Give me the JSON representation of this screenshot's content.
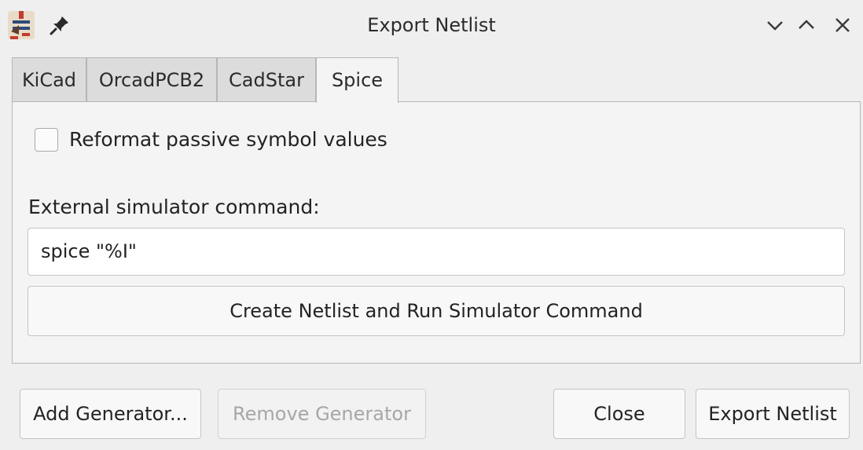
{
  "window": {
    "title": "Export Netlist",
    "icons": {
      "app": "kicad-netlist-app-icon",
      "pin": "pin-icon",
      "minimize": "chevron-down-icon",
      "maximize": "chevron-up-icon",
      "close": "close-icon"
    }
  },
  "tabs": [
    {
      "label": "KiCad",
      "active": false
    },
    {
      "label": "OrcadPCB2",
      "active": false
    },
    {
      "label": "CadStar",
      "active": false
    },
    {
      "label": "Spice",
      "active": true
    }
  ],
  "spice": {
    "reformat_label": "Reformat passive symbol values",
    "reformat_checked": false,
    "command_label": "External simulator command:",
    "command_value": "spice \"%I\"",
    "run_button": "Create Netlist and Run Simulator Command"
  },
  "footer": {
    "add_generator": "Add Generator...",
    "remove_generator": "Remove Generator",
    "remove_enabled": false,
    "close": "Close",
    "export": "Export Netlist"
  },
  "colors": {
    "background": "#efefef",
    "panel": "#f4f4f4",
    "tab_inactive": "#dcdcdc",
    "disabled_text": "#a7a7a7"
  }
}
